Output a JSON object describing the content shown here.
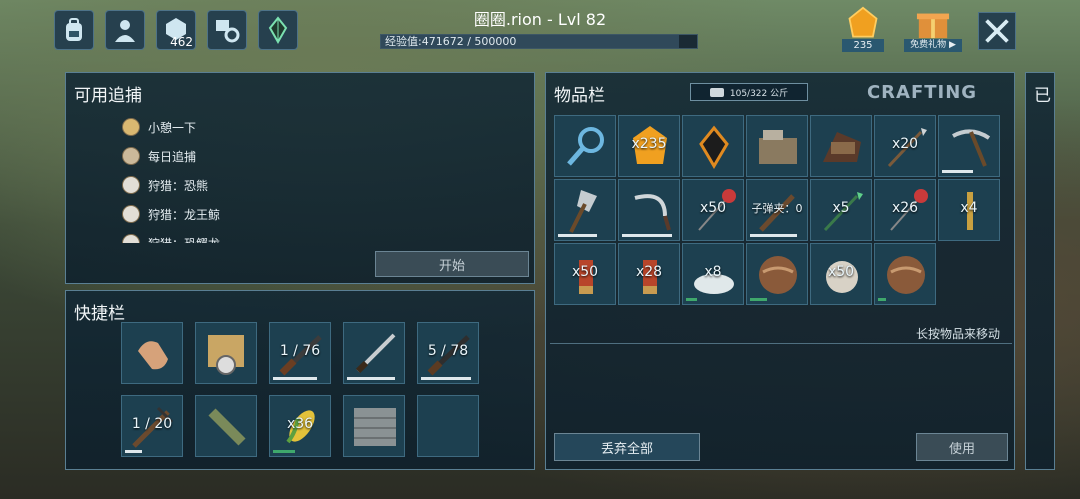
{
  "header": {
    "title": "圈圈.rion - Lvl 82",
    "xp_text": "经验值:471672 / 500000",
    "xp_progress": 0.943,
    "engram_points": "462",
    "gems": "235",
    "free_gift": "免费礼物 ▶"
  },
  "hunts": {
    "title": "可用追捕",
    "items": [
      {
        "label": "小憩一下",
        "icon": "compass-star-icon"
      },
      {
        "label": "每日追捕",
        "icon": "medallion-icon"
      },
      {
        "label": "狩猎：恐熊",
        "icon": "skull-icon"
      },
      {
        "label": "狩猎：龙王鲸",
        "icon": "skull-icon"
      },
      {
        "label": "狩猎：恐鳄龙",
        "icon": "skull-icon"
      }
    ],
    "start_button": "开始"
  },
  "hotbar": {
    "title": "快捷栏",
    "slots": [
      {
        "icon": "hand-icon",
        "qty": "",
        "bar": 0
      },
      {
        "icon": "map-compass-icon",
        "qty": "",
        "bar": 0
      },
      {
        "icon": "rifle-icon",
        "qty": "1 / 76",
        "bar": 0.8
      },
      {
        "icon": "sword-icon",
        "qty": "",
        "bar": 0.85
      },
      {
        "icon": "shotgun-icon",
        "qty": "5 / 78",
        "bar": 0.9
      },
      {
        "icon": "crossbow-icon",
        "qty": "1 / 20",
        "bar": 0.3
      },
      {
        "icon": "spyglass-icon",
        "qty": "",
        "bar": 0
      },
      {
        "icon": "corn-icon",
        "qty": "x36",
        "bar": 0.4
      },
      {
        "icon": "wall-icon",
        "qty": "",
        "bar": 0
      },
      {
        "icon": "empty-slot",
        "qty": "",
        "bar": 0
      }
    ]
  },
  "inventory": {
    "title": "物品栏",
    "weight": "105/322 公斤",
    "crafting_tab": "CRAFTING",
    "hint": "长按物品来移动",
    "drop_all": "丢弃全部",
    "use": "使用",
    "slots": [
      {
        "icon": "search-icon",
        "qty": "",
        "bar": 0
      },
      {
        "icon": "amber-icon",
        "qty": "x235",
        "bar": 0
      },
      {
        "icon": "implant-icon",
        "qty": "",
        "bar": 0
      },
      {
        "icon": "workbench-icon",
        "qty": "",
        "bar": 0
      },
      {
        "icon": "bed-icon",
        "qty": "",
        "bar": 0
      },
      {
        "icon": "spear-icon",
        "qty": "x20",
        "bar": 0
      },
      {
        "icon": "pickaxe-icon",
        "qty": "",
        "bar": 0.55
      },
      {
        "icon": "hatchet-icon",
        "qty": "",
        "bar": 0.7
      },
      {
        "icon": "sickle-icon",
        "qty": "",
        "bar": 0.9
      },
      {
        "icon": "tranq-arrow-icon",
        "qty": "x50",
        "bar": 0
      },
      {
        "icon": "crossbow-icon",
        "qty": "子弹夹：0",
        "bar": 0.85
      },
      {
        "icon": "green-spear-icon",
        "qty": "x5",
        "bar": 0
      },
      {
        "icon": "tranq-arrow-icon",
        "qty": "x26",
        "bar": 0
      },
      {
        "icon": "bar-icon",
        "qty": "x4",
        "bar": 0
      },
      {
        "icon": "cartridge-icon",
        "qty": "x50",
        "bar": 0
      },
      {
        "icon": "cartridge-icon",
        "qty": "x28",
        "bar": 0
      },
      {
        "icon": "salt-icon",
        "qty": "x8",
        "bar": 0.2
      },
      {
        "icon": "fossil-icon",
        "qty": "",
        "bar": 0.3
      },
      {
        "icon": "pearl-icon",
        "qty": "x50",
        "bar": 0
      },
      {
        "icon": "fossil-icon",
        "qty": "",
        "bar": 0.15
      }
    ]
  },
  "right_edge_label": "已"
}
